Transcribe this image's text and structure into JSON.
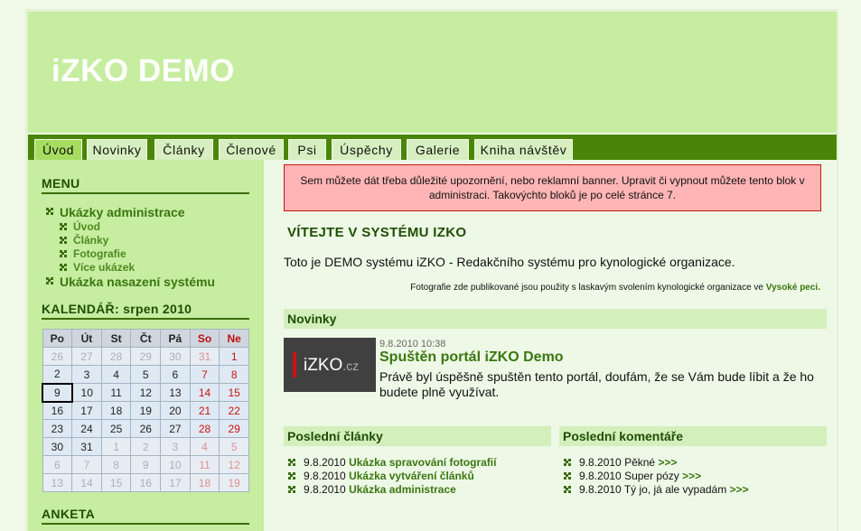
{
  "site": {
    "title": "iZKO DEMO"
  },
  "nav": {
    "tabs": [
      {
        "label": "Úvod"
      },
      {
        "label": "Novinky"
      },
      {
        "label": "Články"
      },
      {
        "label": "Členové"
      },
      {
        "label": "Psi"
      },
      {
        "label": "Úspěchy"
      },
      {
        "label": "Galerie"
      },
      {
        "label": "Kniha návštěv"
      }
    ],
    "active": "Úvod"
  },
  "sidebar": {
    "menu_heading": "MENU",
    "menu": [
      {
        "label": "Ukázky administrace",
        "children": [
          "Úvod",
          "Články",
          "Fotografie",
          "Více ukázek"
        ]
      },
      {
        "label": "Ukázka nasazení systému"
      }
    ],
    "calendar_heading": "KALENDÁŘ: srpen 2010",
    "calendar": {
      "weekdays": [
        "Po",
        "Út",
        "St",
        "Čt",
        "Pá",
        "So",
        "Ne"
      ],
      "weeks": [
        [
          "26",
          "27",
          "28",
          "29",
          "30",
          "31",
          "1"
        ],
        [
          "2",
          "3",
          "4",
          "5",
          "6",
          "7",
          "8"
        ],
        [
          "9",
          "10",
          "11",
          "12",
          "13",
          "14",
          "15"
        ],
        [
          "16",
          "17",
          "18",
          "19",
          "20",
          "21",
          "22"
        ],
        [
          "23",
          "24",
          "25",
          "26",
          "27",
          "28",
          "29"
        ],
        [
          "30",
          "31",
          "1",
          "2",
          "3",
          "4",
          "5"
        ],
        [
          "6",
          "7",
          "8",
          "9",
          "10",
          "11",
          "12"
        ],
        [
          "13",
          "14",
          "15",
          "16",
          "17",
          "18",
          "19"
        ]
      ],
      "today": "9"
    },
    "poll_heading": "ANKETA"
  },
  "main": {
    "banner": "Sem můžete dát třeba důležité upozornění, nebo reklamní banner. Upravit či vypnout můžete tento blok v administraci. Takovýchto bloků je po celé stránce 7.",
    "welcome": "VÍTEJTE V SYSTÉMU IZKO",
    "intro": "Toto je DEMO systému iZKO - Redakčního systému pro kynologické organizace.",
    "photo_note": "Fotografie zde publikované jsou použity s laskavým svolením kynologické organizace ve",
    "photo_note_link": "Vysoké peci.",
    "news_heading": "Novinky",
    "news": {
      "image_logo": "iZKO",
      "image_logo_suffix": ".cz",
      "date": "9.8.2010 10:38",
      "title": "Spuštěn portál iZKO Demo",
      "text": "Právě byl úspěšně spuštěn tento portál, doufám, že se Vám bude líbit a že ho budete plně využívat."
    },
    "articles_heading": "Poslední články",
    "articles": [
      {
        "date": "9.8.2010",
        "title": "Ukázka spravování fotografií"
      },
      {
        "date": "9.8.2010",
        "title": "Ukázka vytváření článků"
      },
      {
        "date": "9.8.2010",
        "title": "Ukázka administrace"
      }
    ],
    "comments_heading": "Poslední komentáře",
    "comments": [
      {
        "date": "9.8.2010",
        "text": "Pěkné",
        "link": ">>>"
      },
      {
        "date": "9.8.2010",
        "text": "Super pózy",
        "link": ">>>"
      },
      {
        "date": "9.8.2010",
        "text": "Tý jo, já ale vypadám",
        "link": ">>>"
      }
    ]
  }
}
